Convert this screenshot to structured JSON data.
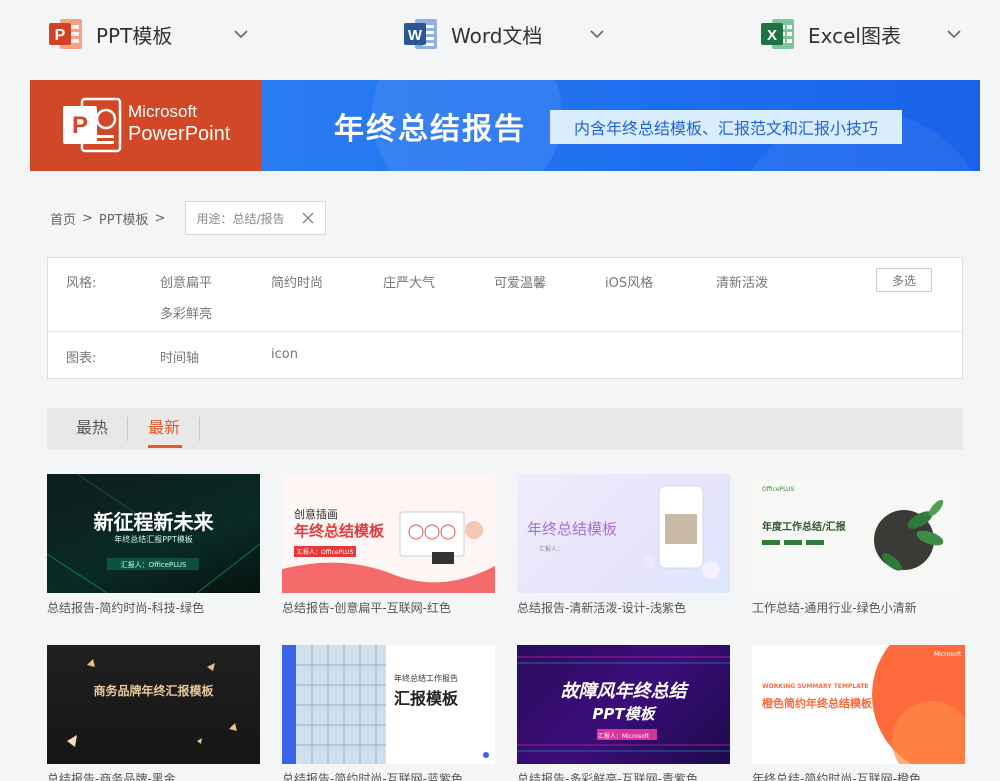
{
  "apps": [
    {
      "label": "PPT模板",
      "glyph": "P",
      "color": "#d04423"
    },
    {
      "label": "Word文档",
      "glyph": "W",
      "color": "#2b5797"
    },
    {
      "label": "Excel图表",
      "glyph": "X",
      "color": "#207245"
    }
  ],
  "banner": {
    "brand_line1": "Microsoft",
    "brand_line2": "PowerPoint",
    "brand_glyph": "P",
    "title": "年终总结报告",
    "subtitle": "内含年终总结模板、汇报范文和汇报小技巧"
  },
  "breadcrumb": {
    "home": "首页",
    "sep": ">",
    "section": "PPT模板",
    "filter_tag": "用途：总结/报告"
  },
  "filters": {
    "style_label": "风格:",
    "style_options": [
      "创意扁平",
      "简约时尚",
      "庄严大气",
      "可爱温馨",
      "iOS风格",
      "清新活泼",
      "多彩鲜亮"
    ],
    "multi_select": "多选",
    "chart_label": "图表:",
    "chart_options": [
      "时间轴",
      "icon"
    ]
  },
  "tabs": {
    "hot": "最热",
    "new": "最新"
  },
  "cards": [
    {
      "caption": "总结报告-简约时尚-科技-绿色",
      "thumb": {
        "line1": "新征程新未来",
        "line2": "年终总结汇报PPT模板",
        "line3": "汇报人：OfficePLUS"
      }
    },
    {
      "caption": "总结报告-创意扁平-互联网-红色",
      "thumb": {
        "line1": "创意插画",
        "line2": "年终总结模板",
        "line3": "汇报人：OfficePLUS"
      }
    },
    {
      "caption": "总结报告-清新活泼-设计-浅紫色",
      "thumb": {
        "line1": "年终总结模板",
        "line2": "汇报人："
      }
    },
    {
      "caption": "工作总结-通用行业-绿色小清新",
      "thumb": {
        "line1": "年度工作总结/汇报",
        "line2": "OfficePLUS"
      }
    },
    {
      "caption": "总结报告-商务品牌-黑金",
      "thumb": {
        "line1": "商务品牌年终汇报模板"
      }
    },
    {
      "caption": "总结报告-简约时尚-互联网-蓝紫色",
      "thumb": {
        "line1": "年终总结工作报告",
        "line2": "汇报模板"
      }
    },
    {
      "caption": "总结报告-多彩鲜亮-互联网-青紫色",
      "thumb": {
        "line1": "故障风年终总结",
        "line2": "PPT模板",
        "line3": "汇报人：Microsoft"
      }
    },
    {
      "caption": "年终总结-简约时尚-互联网-橙色",
      "thumb": {
        "line1": "WORKING SUMMARY TEMPLATE",
        "line2": "橙色简约年终总结模板",
        "line3": "Microsoft"
      }
    }
  ]
}
